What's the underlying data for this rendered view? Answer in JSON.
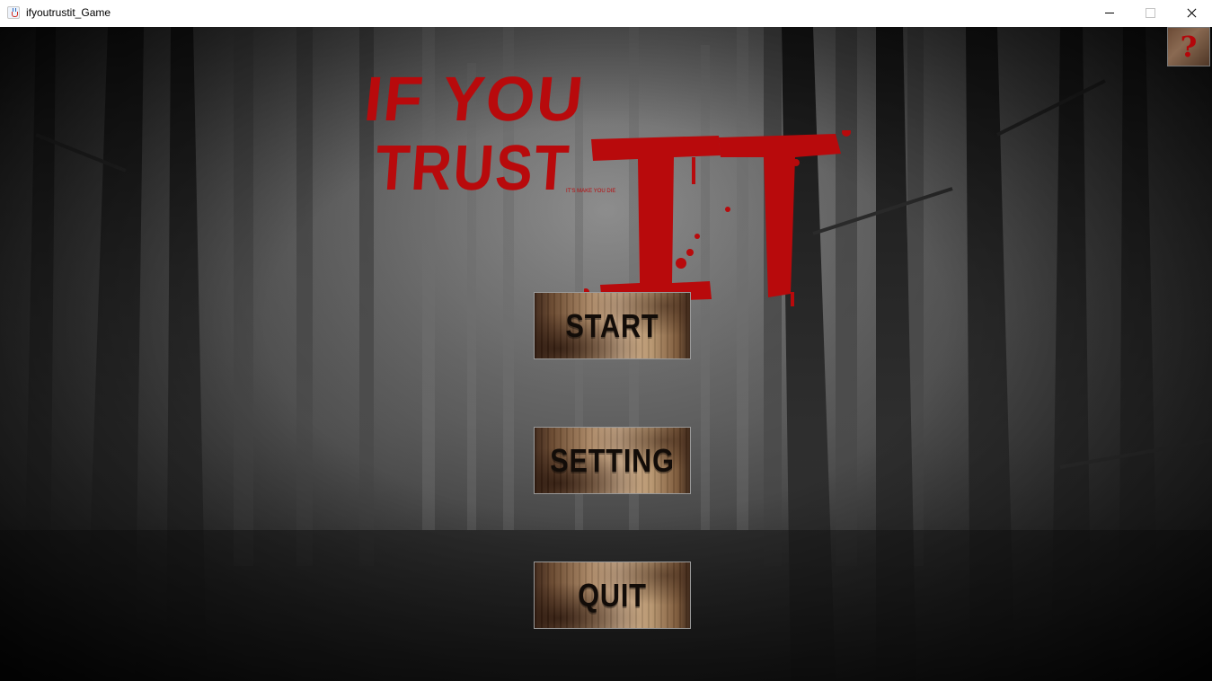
{
  "window": {
    "title": "ifyoutrustit_Game",
    "icon": "java-cup-icon",
    "controls": [
      "minimize",
      "maximize",
      "close"
    ]
  },
  "game": {
    "logo": {
      "line1": "IF YOU",
      "line2": "TRUST",
      "big_text": "IT",
      "tagline": "IT'S MAKE YOU DIE",
      "color": "#b80a0c"
    },
    "help_button": {
      "glyph": "?",
      "icon": "question-mark-icon"
    },
    "menu": {
      "start_label": "START",
      "setting_label": "SETTING",
      "quit_label": "QUIT"
    }
  }
}
